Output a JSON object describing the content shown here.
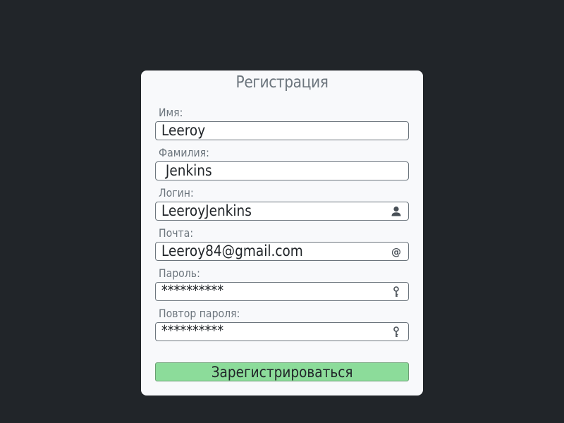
{
  "form": {
    "title": "Регистрация",
    "fields": [
      {
        "label": "Имя:",
        "value": "Leeroy",
        "icon": ""
      },
      {
        "label": "Фамилия:",
        "value": " Jenkins",
        "icon": ""
      },
      {
        "label": "Логин:",
        "value": "LeeroyJenkins",
        "icon": "user-icon"
      },
      {
        "label": "Почта:",
        "value": "Leeroy84@gmail.com",
        "icon": "at-icon"
      },
      {
        "label": "Пароль:",
        "value": "**********",
        "icon": "key-icon"
      },
      {
        "label": "Повтор пароля:",
        "value": "**********",
        "icon": "key-icon"
      }
    ],
    "submit_label": "Зарегистрироваться"
  },
  "colors": {
    "background": "#212529",
    "card": "#f8f9fb",
    "label": "#6c757d",
    "submit": "#8cdc9a"
  }
}
